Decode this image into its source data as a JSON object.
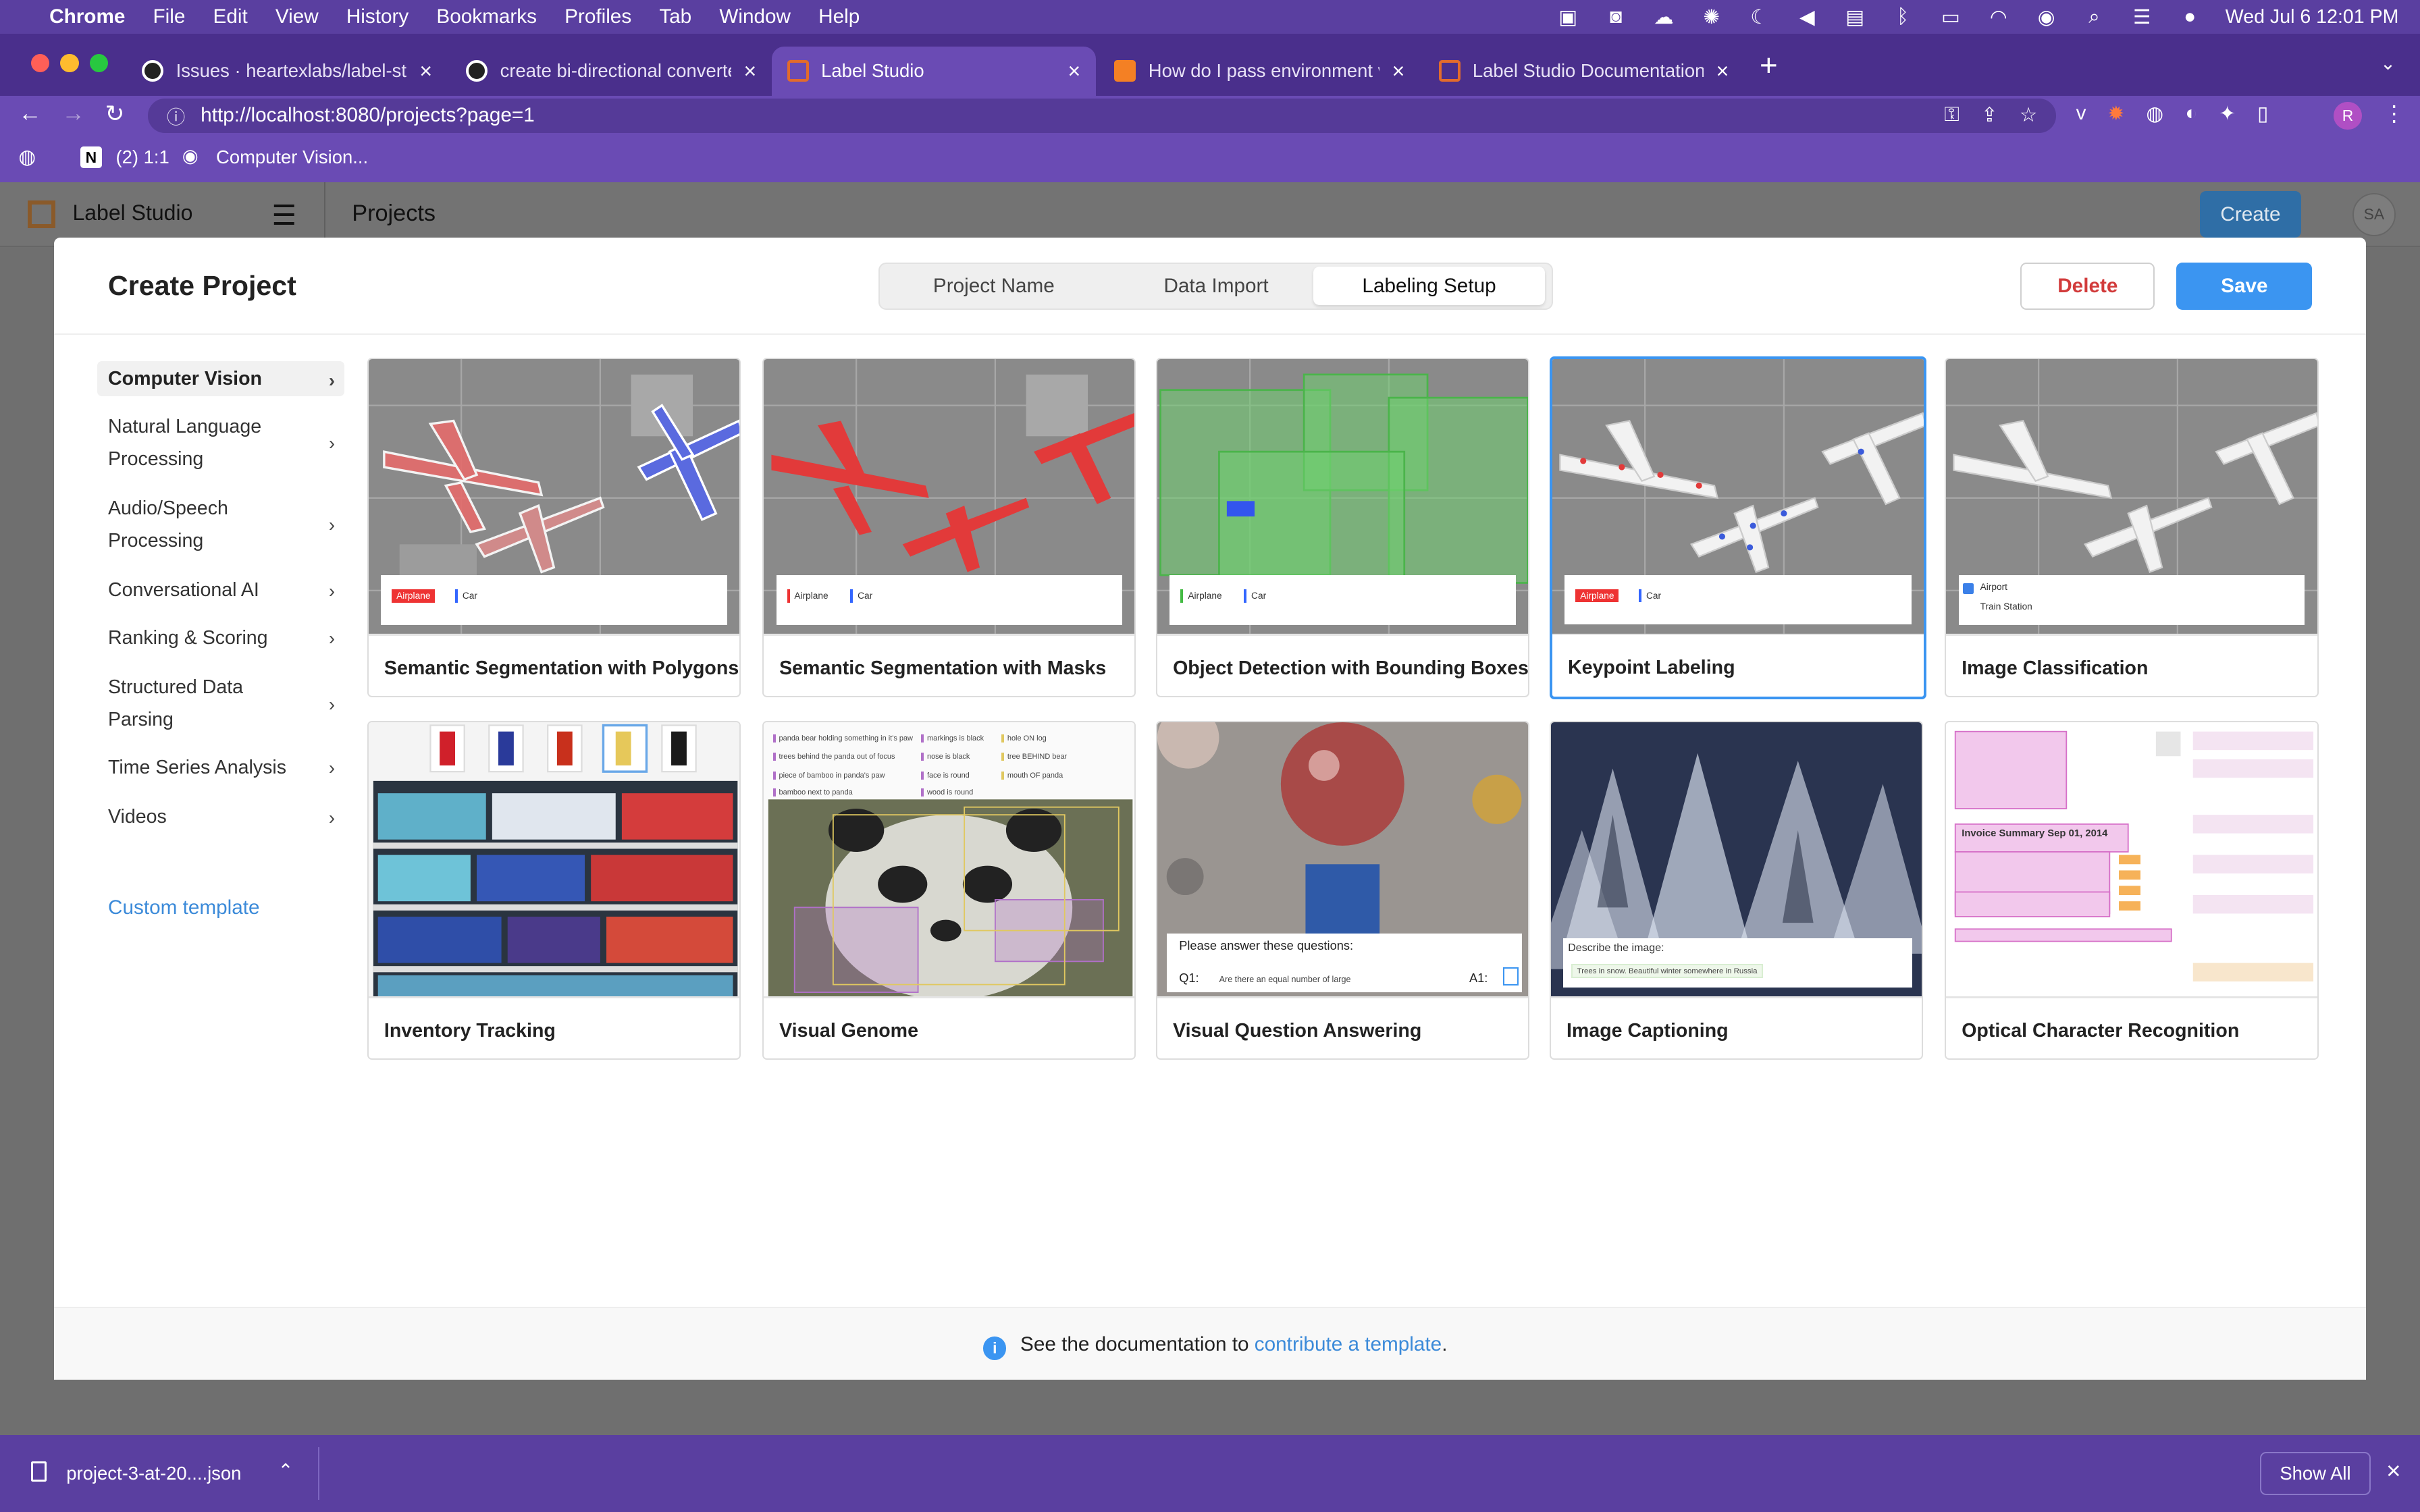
{
  "menubar": {
    "app": "Chrome",
    "items": [
      "File",
      "Edit",
      "View",
      "History",
      "Bookmarks",
      "Profiles",
      "Tab",
      "Window",
      "Help"
    ],
    "clock": "Wed Jul 6  12:01 PM"
  },
  "browser": {
    "tabs": [
      {
        "title": "Issues · heartexlabs/label-studi"
      },
      {
        "title": "create bi-directional converter"
      },
      {
        "title": "Label Studio"
      },
      {
        "title": "How do I pass environment var"
      },
      {
        "title": "Label Studio Documentation —"
      }
    ],
    "url": "http://localhost:8080/projects?page=1",
    "bookmarks": [
      "(2) 1:1",
      "Computer Vision..."
    ],
    "profile_initial": "R"
  },
  "app": {
    "brand": "Label Studio",
    "breadcrumb": "Projects",
    "create_label": "Create",
    "avatar": "SA"
  },
  "modal": {
    "title": "Create Project",
    "steps": [
      "Project Name",
      "Data Import",
      "Labeling Setup"
    ],
    "active_step": "Labeling Setup",
    "delete_label": "Delete",
    "save_label": "Save",
    "categories": [
      "Computer Vision",
      "Natural Language Processing",
      "Audio/Speech Processing",
      "Conversational AI",
      "Ranking & Scoring",
      "Structured Data Parsing",
      "Time Series Analysis",
      "Videos"
    ],
    "custom_template": "Custom template",
    "templates": [
      "Semantic Segmentation with Polygons",
      "Semantic Segmentation with Masks",
      "Object Detection with Bounding Boxes",
      "Keypoint Labeling",
      "Image Classification",
      "Inventory Tracking",
      "Visual Genome",
      "Visual Question Answering",
      "Image Captioning",
      "Optical Character Recognition"
    ],
    "selected_template": "Keypoint Labeling",
    "thumb_text": {
      "airplane": "Airplane",
      "car": "Car",
      "airport": "Airport",
      "train_station": "Train Station",
      "vqa_prompt": "Please answer these questions:",
      "vqa_q": "Q1:",
      "vqa_a": "A1:",
      "vqa_line": "Are there an equal number of large",
      "caption_prompt": "Describe the image:",
      "caption_value": "Trees in snow. Beautiful winter somewhere in Russia",
      "ocr_title": "Invoice Summary Sep 01, 2014",
      "genome_notes": [
        "panda bear holding something in it's paw",
        "trees behind the panda out of focus",
        "piece of bamboo in panda's paw",
        "bamboo next to panda",
        "markings is black",
        "nose is black",
        "face is round",
        "wood is round",
        "hole ON log",
        "tree BEHIND bear",
        "mouth OF panda"
      ]
    },
    "footer_prefix": "See the documentation to ",
    "footer_link": "contribute a template",
    "footer_suffix": "."
  },
  "downloads": {
    "file": "project-3-at-20....json",
    "show_all": "Show All"
  },
  "colors": {
    "accent": "#3b95f1",
    "danger": "#d23b3b",
    "browser_purple": "#6a4bb4"
  }
}
